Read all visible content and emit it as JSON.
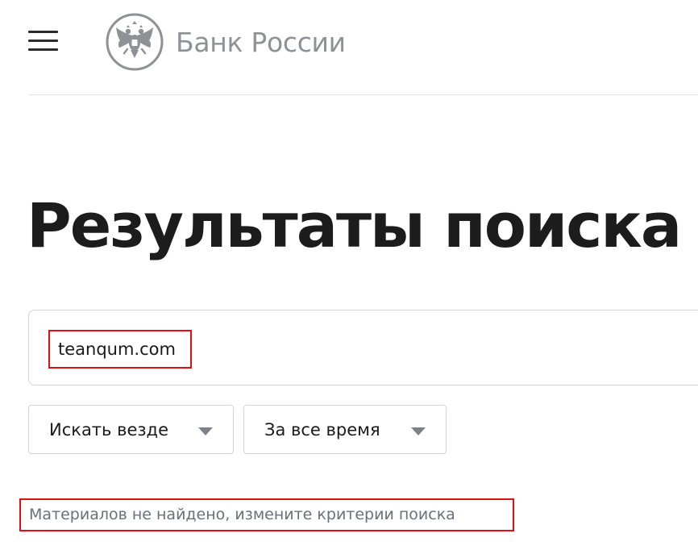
{
  "header": {
    "menu_icon": "hamburger-menu-icon",
    "logo_icon": "double-headed-eagle-emblem-icon",
    "logo_text": "Банк России"
  },
  "main": {
    "title": "Результаты поиска",
    "search": {
      "value": "teanqum.com"
    },
    "filters": {
      "where": {
        "selected": "Искать везде",
        "icon": "caret-down-icon"
      },
      "when": {
        "selected": "За все время",
        "icon": "caret-down-icon"
      }
    },
    "message": "Материалов не найдено, измените критерии поиска"
  },
  "colors": {
    "highlight_border": "#e01010",
    "logo_gray": "#8f9196",
    "message_gray": "#6b7079",
    "title": "#1c1c1c"
  }
}
